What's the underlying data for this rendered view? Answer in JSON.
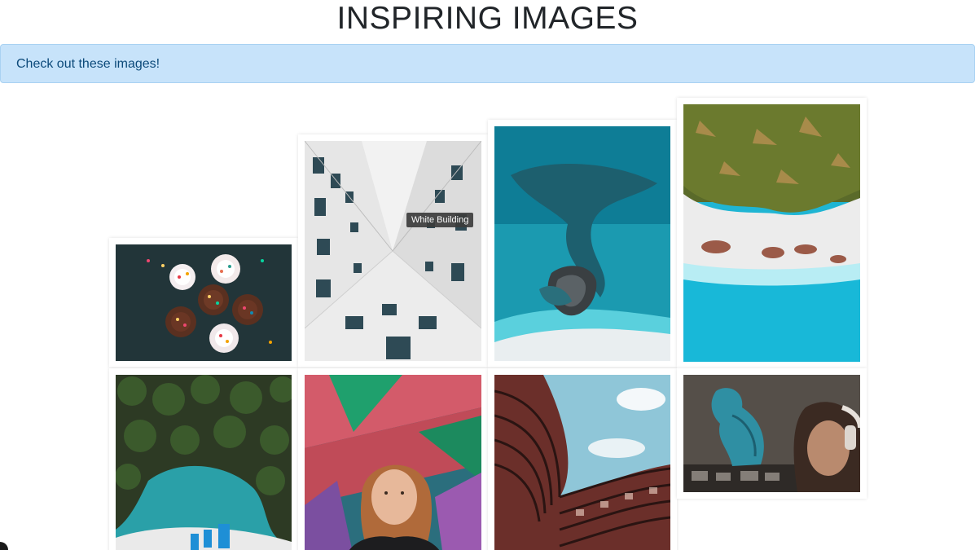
{
  "header": {
    "title": "INSPIRING IMAGES"
  },
  "alert": {
    "text": "Check out these images!"
  },
  "gallery": {
    "items": [
      {
        "name": "cupcakes-image"
      },
      {
        "name": "white-building-image",
        "tooltip": "White Building"
      },
      {
        "name": "reef-aerial-image"
      },
      {
        "name": "palm-beach-image"
      },
      {
        "name": "palm-lagoon-image"
      },
      {
        "name": "graffiti-portrait-image"
      },
      {
        "name": "curved-building-image"
      },
      {
        "name": "mural-headphones-image"
      }
    ]
  }
}
